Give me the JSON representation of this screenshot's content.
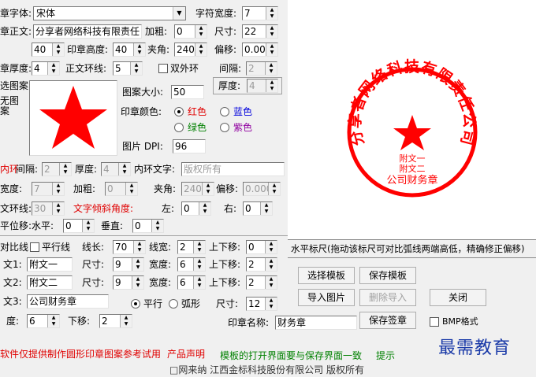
{
  "font_row": {
    "font_label": "章字体:",
    "font_value": "宋体",
    "char_width_label": "字符宽度:",
    "char_width_value": "7"
  },
  "text_row": {
    "label": "章正文:",
    "value": "分享者网络科技有限责任",
    "bold_label": "加粗:",
    "bold_value": "0",
    "size_label": "尺寸:",
    "size_value": "22"
  },
  "dims_row": {
    "width_value": "40",
    "height_label": "印章高度:",
    "height_value": "40",
    "angle_label": "夹角:",
    "angle_value": "240",
    "offset_label": "偏移:",
    "offset_value": "0.000"
  },
  "ring_row": {
    "thick_label": "章厚度:",
    "thick_value": "4",
    "ring_label": "正文环线:",
    "ring_value": "5",
    "double_label": "双外环",
    "spacing_label": "间隔:",
    "spacing_value": "2",
    "thickness2_label": "厚度:",
    "thickness2_value": "4"
  },
  "pattern": {
    "label": "选图案:",
    "none_label": "无图案",
    "size_label": "图案大小:",
    "size_value": "50",
    "color_label": "印章颜色:",
    "colors": [
      "红色",
      "蓝色",
      "绿色",
      "紫色"
    ],
    "dpi_label": "图片 DPI:",
    "dpi_value": "96"
  },
  "inner_row": {
    "label": "内环",
    "spacing_label": "间隔:",
    "spacing_value": "2",
    "thick_label": "厚度:",
    "thick_value": "4",
    "text_label": "内环文字:",
    "text_value": "版权所有"
  },
  "width2_row": {
    "width_label": "宽度:",
    "width_value": "7",
    "bold_label": "加粗:",
    "bold_value": "0",
    "angle_label": "夹角:",
    "angle_value": "240",
    "offset_label": "偏移:",
    "offset_value": "0.000"
  },
  "ring2_row": {
    "label": "文环线:",
    "value": "30",
    "tilt_label": "文字倾斜角度:",
    "left_label": "左:",
    "left_value": "0",
    "right_label": "右:",
    "right_value": "0"
  },
  "move_row": {
    "label": "平位移:",
    "h_label": "水平:",
    "h_value": "0",
    "v_label": "垂直:",
    "v_value": "0"
  },
  "contrast_row": {
    "contrast_label": "对比线",
    "parallel_label": "平行线",
    "len_label": "线长:",
    "len_value": "70",
    "lw_label": "线宽:",
    "lw_value": "2",
    "ud_label": "上下移:",
    "ud_value": "0"
  },
  "text1_row": {
    "label": "文1:",
    "value": "附文一",
    "size_label": "尺寸:",
    "size_value": "9",
    "w_label": "宽度:",
    "w_value": "6",
    "ud_label": "上下移:",
    "ud_value": "2"
  },
  "text2_row": {
    "label": "文2:",
    "value": "附文二",
    "size_label": "尺寸:",
    "size_value": "9",
    "w_label": "宽度:",
    "w_value": "6",
    "ud_label": "上下移:",
    "ud_value": "2"
  },
  "text3_row": {
    "label": "文3:",
    "value": "公司财务章",
    "parallel_label": "平行",
    "arc_label": "弧形",
    "size_label": "尺寸:",
    "size_value": "12"
  },
  "last_row": {
    "deg_label": "度:",
    "deg_value": "6",
    "down_label": "下移:",
    "down_value": "2",
    "name_label": "印章名称:",
    "name_value": "财务章",
    "bmp_label": "BMP格式"
  },
  "ruler_label": "水平标尺(拖动该标尺可对比弧线两端高低，精确修正偏移)",
  "buttons": {
    "select_template": "选择模板",
    "save_template": "保存模板",
    "import_image": "导入图片",
    "delete_import": "删除导入",
    "close": "关闭",
    "save_stamp": "保存签章"
  },
  "footer": {
    "disclaimer": "软件仅提供制作圆形印章图案参考试用",
    "statement": "产品声明",
    "tip_text": "模板的打开界面要与保存界面一致",
    "tip": "提示",
    "bottom_text": "□网来纳    江西金标科技股份有限公司    版权所有"
  },
  "stamp": {
    "arc_text": "分享者网络科技有限责任公司",
    "line1": "附文一",
    "line2": "附文二",
    "line3": "公司财务章",
    "color": "#ff0000"
  },
  "watermark": "最需教育"
}
